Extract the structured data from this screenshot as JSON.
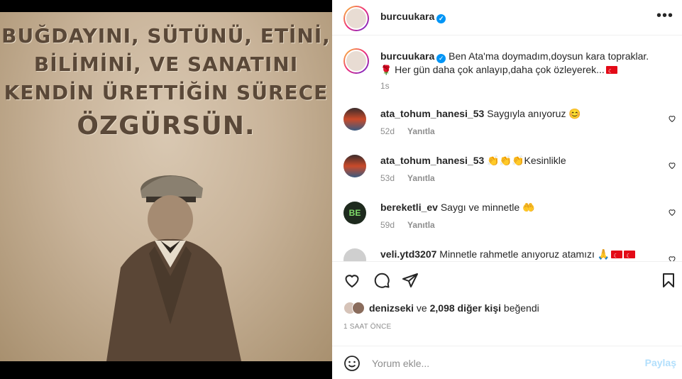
{
  "post": {
    "author": "burcuukara",
    "poster_lines": [
      "BUĞDAYINI, SÜTÜNÜ, ETİNİ,",
      "BİLİMİNİ, VE SANATINI",
      "KENDİN ÜRETTİĞİN SÜRECE"
    ],
    "poster_big": "ÖZGÜRSÜN.",
    "caption_text": "Ben Ata'ma doymadım,doysun kara topraklar.",
    "caption_text2": "Her gün daha çok anlayıp,daha çok özleyerek...",
    "caption_time": "1s",
    "likes_user": "denizseki",
    "likes_mid": " ve ",
    "likes_count": "2,098 diğer kişi",
    "likes_end": " beğendi",
    "posted_ago": "1 SAAT ÖNCE"
  },
  "comments": [
    {
      "user": "ata_tohum_hanesi_53",
      "text": "Saygıyla anıyoruz 😊",
      "age": "52d",
      "reply": "Yanıtla"
    },
    {
      "user": "ata_tohum_hanesi_53",
      "text": "👏👏👏Kesinlikle",
      "age": "53d",
      "reply": "Yanıtla"
    },
    {
      "user": "bereketli_ev",
      "text": "Saygı ve minnetle 🤲",
      "age": "59d",
      "reply": "Yanıtla"
    },
    {
      "user": "veli.ytd3207",
      "text": "Minnetle rahmetle anıyoruz atamızı 🙏",
      "age": "",
      "reply": ""
    }
  ],
  "add_comment": {
    "placeholder": "Yorum ekle...",
    "post_label": "Paylaş"
  },
  "icons": {
    "more": "more-options-icon",
    "heart": "heart-icon",
    "comment": "comment-icon",
    "share": "share-icon",
    "save": "bookmark-icon",
    "emoji": "emoji-icon"
  },
  "colors": {
    "accent": "#0095f6",
    "muted": "#8e8e8e",
    "post_disabled": "#b2dffc"
  }
}
